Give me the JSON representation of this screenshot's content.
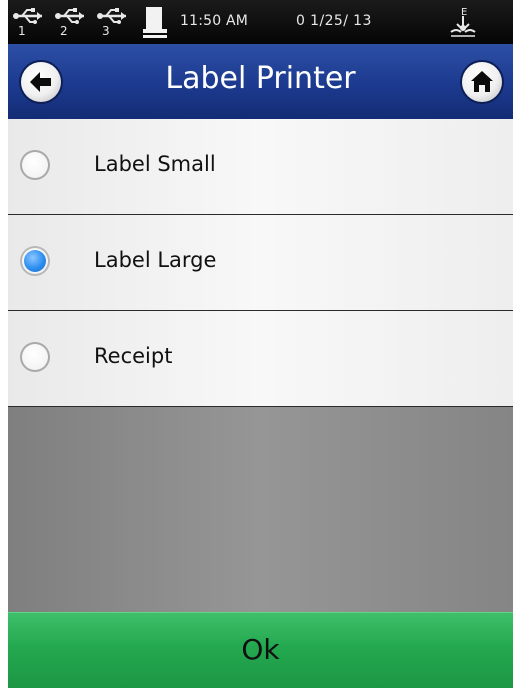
{
  "status_bar": {
    "usb_ports": [
      "1",
      "2",
      "3"
    ],
    "time": "11:50 AM",
    "date": "0 1/25/ 13",
    "icons": [
      "usb-icon",
      "printer-icon",
      "power-connection-icon"
    ]
  },
  "header": {
    "title": "Label Printer",
    "back_icon": "back-arrow-icon",
    "home_icon": "home-icon"
  },
  "options": [
    {
      "label": "Label Small",
      "selected": false
    },
    {
      "label": "Label Large",
      "selected": true
    },
    {
      "label": "Receipt",
      "selected": false
    }
  ],
  "footer": {
    "ok_label": "Ok"
  },
  "colors": {
    "header_blue": "#1c3a8f",
    "ok_green": "#23a84f",
    "radio_selected": "#2d8ff0"
  }
}
